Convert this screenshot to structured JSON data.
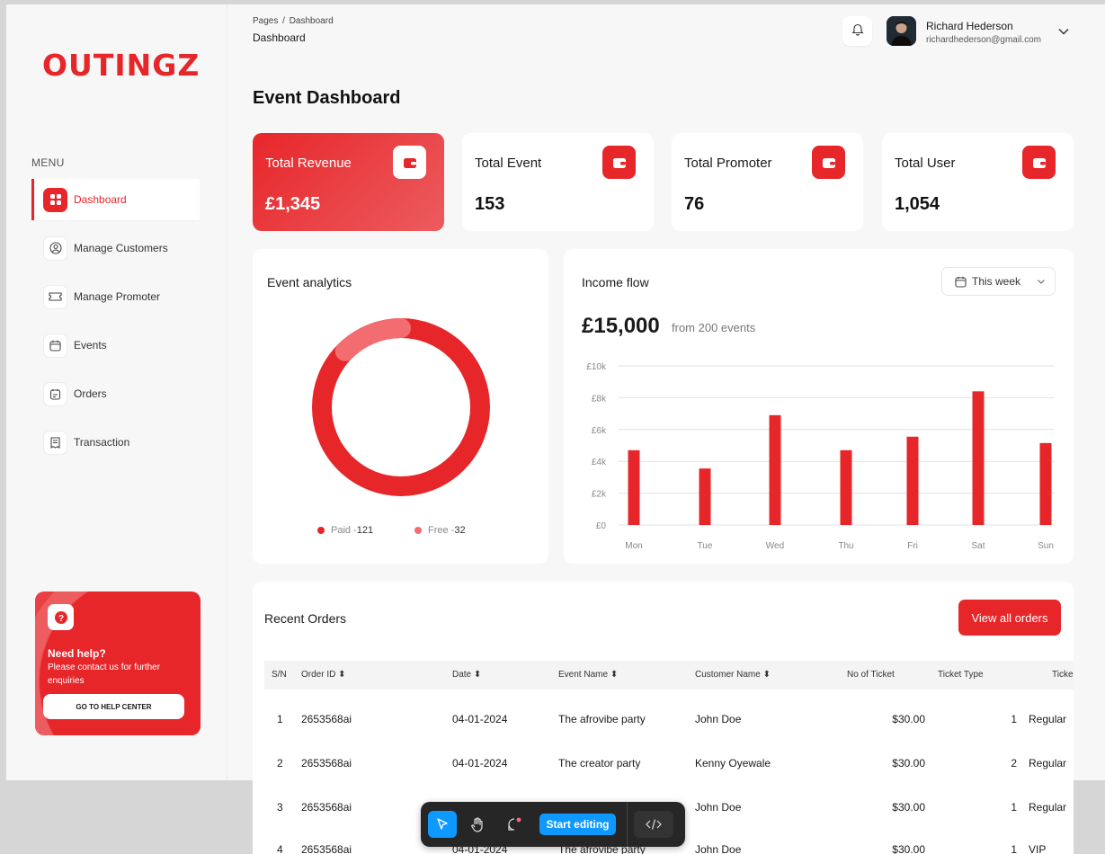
{
  "brand": {
    "logo": "OUTINGZ",
    "accent": "#e7262a"
  },
  "sidebar": {
    "menu_label": "MENU",
    "items": [
      {
        "label": "Dashboard",
        "icon": "grid-icon",
        "active": true
      },
      {
        "label": "Manage Customers",
        "icon": "user-circle-icon"
      },
      {
        "label": "Manage Promoter",
        "icon": "ticket-icon"
      },
      {
        "label": "Events",
        "icon": "calendar-icon"
      },
      {
        "label": "Orders",
        "icon": "clipboard-icon"
      },
      {
        "label": "Transaction",
        "icon": "receipt-icon"
      }
    ],
    "help": {
      "title": "Need help?",
      "text": "Please contact us for further enquiries",
      "button": "GO TO HELP CENTER"
    }
  },
  "header": {
    "breadcrumb_root": "Pages",
    "breadcrumb_sep": "/",
    "breadcrumb_leaf": "Dashboard",
    "current": "Dashboard",
    "user_name": "Richard Hederson",
    "user_email": "richardhederson@gmail.com"
  },
  "page_title": "Event Dashboard",
  "stats": [
    {
      "label": "Total Revenue",
      "value": "£1,345"
    },
    {
      "label": "Total Event",
      "value": "153"
    },
    {
      "label": "Total Promoter",
      "value": "76"
    },
    {
      "label": "Total User",
      "value": "1,054"
    }
  ],
  "analytics": {
    "title": "Event analytics",
    "legend": [
      {
        "label": "Paid - ",
        "value": "121",
        "color": "#e7262a"
      },
      {
        "label": "Free - ",
        "value": "32",
        "color": "#f36c6f"
      }
    ]
  },
  "income": {
    "title": "Income flow",
    "period": "This week",
    "amount": "£15,000",
    "subtitle": "from 200 events"
  },
  "chart_data": {
    "type": "bar",
    "categories": [
      "Mon",
      "Tue",
      "Wed",
      "Thu",
      "Fri",
      "Sat",
      "Sun"
    ],
    "values": [
      4700,
      3550,
      6900,
      4700,
      5550,
      8400,
      5150
    ],
    "y_ticks": [
      "£0",
      "£2k",
      "£4k",
      "£6k",
      "£8k",
      "£10k"
    ],
    "ylim": [
      0,
      10000
    ],
    "grid": true,
    "color": "#e7262a"
  },
  "orders": {
    "title": "Recent Orders",
    "view_all": "View all orders",
    "columns": [
      "S/N",
      "Order ID",
      "Date",
      "Event Name",
      "Customer Name",
      "No of Ticket",
      "Ticket Type",
      "Ticke"
    ],
    "rows": [
      {
        "sn": "1",
        "id": "2653568ai",
        "date": "04-01-2024",
        "event": "The afrovibe party",
        "customer": "John Doe",
        "amount": "$30.00",
        "qty": "1",
        "type": "Regular"
      },
      {
        "sn": "2",
        "id": "2653568ai",
        "date": "04-01-2024",
        "event": "The creator party",
        "customer": "Kenny Oyewale",
        "amount": "$30.00",
        "qty": "2",
        "type": "Regular"
      },
      {
        "sn": "3",
        "id": "2653568ai",
        "date": "",
        "event": "",
        "customer": "John Doe",
        "amount": "$30.00",
        "qty": "1",
        "type": "Regular"
      },
      {
        "sn": "4",
        "id": "2653568ai",
        "date": "04-01-2024",
        "event": "The afrovibe party",
        "customer": "John Doe",
        "amount": "$30.00",
        "qty": "1",
        "type": "VIP"
      }
    ]
  },
  "toolbar": {
    "edit_label": "Start editing"
  }
}
